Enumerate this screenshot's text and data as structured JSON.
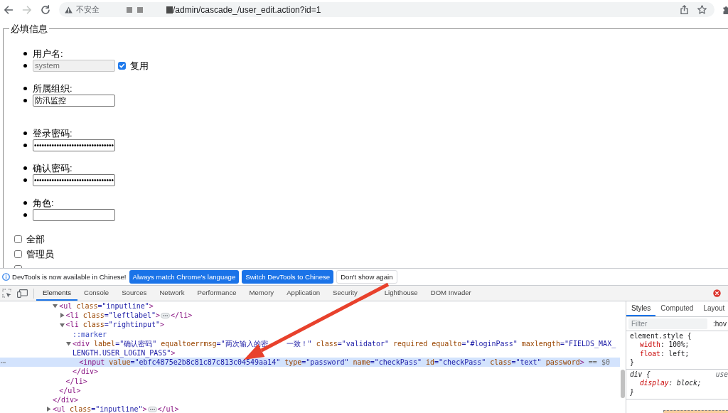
{
  "browser": {
    "nav_buttons": [
      {
        "disabled": false
      },
      {
        "disabled": true
      },
      {
        "disabled": false
      }
    ],
    "address_bar": {
      "security_label": "不安全",
      "url": "/admin/cascade_/user_edit.action?id=1"
    }
  },
  "page": {
    "legend": "必填信息",
    "fields": [
      {
        "label": "用户名:",
        "kind": "text",
        "value": "system",
        "disabled": true,
        "reuse": {
          "label": "复用",
          "checked": true
        }
      },
      {
        "label": "所属组织:",
        "kind": "text",
        "value": "防汛监控",
        "disabled": false
      },
      {
        "label": "登录密码:",
        "kind": "password",
        "value": "••••••••••••••••••••••••••••••••",
        "disabled": false
      },
      {
        "label": "确认密码:",
        "kind": "password",
        "value": "••••••••••••••••••••••••••••••••",
        "disabled": false
      },
      {
        "label": "角色:",
        "kind": "text",
        "disabled": false
      }
    ],
    "roles": [
      {
        "label": "全部",
        "checked": false
      },
      {
        "label": "管理员",
        "checked": false
      },
      {
        "checked": false
      }
    ]
  },
  "devtools": {
    "banner": {
      "message": "DevTools is now available in Chinese!",
      "buttons": [
        {
          "label": "Always match Chrome's language",
          "kind": "primary"
        },
        {
          "label": "Switch DevTools to Chinese",
          "kind": "primary"
        },
        {
          "label": "Don't show again",
          "kind": "secondary"
        }
      ]
    },
    "tabs": [
      {
        "label": "Elements",
        "selected": true
      },
      {
        "label": "Console",
        "selected": false
      },
      {
        "label": "Sources",
        "selected": false
      },
      {
        "label": "Network",
        "selected": false
      },
      {
        "label": "Performance",
        "selected": false
      },
      {
        "label": "Memory",
        "selected": false
      },
      {
        "label": "Application",
        "selected": false
      },
      {
        "label": "Security",
        "selected": false
      },
      {
        "label": "Lighthouse",
        "selected": false
      },
      {
        "label": "DOM Invader",
        "selected": false
      }
    ],
    "dom_tree": [
      {
        "kind": "element",
        "selected": false,
        "close_tag": "</div>",
        "children": [
          {
            "kind": "element",
            "open_tag": "<ul class=\"inputline\">",
            "expanded": true,
            "selected": false,
            "close_tag": "</ul>",
            "children": [
              {
                "kind": "element",
                "open_tag": "<li class=\"leftlabel\">",
                "expanded": false,
                "selected": false,
                "close_tag": "</li>"
              },
              {
                "kind": "element",
                "open_tag": "<li class=\"rightinput\">",
                "expanded": true,
                "selected": false,
                "close_tag": "</li>",
                "children": [
                  {
                    "kind": "pseudo",
                    "text": "::marker"
                  },
                  {
                    "kind": "element",
                    "open_tag": [
                      "<div label=\"确认密码\" equaltoerrmsg=\"两次输入的密",
                      "一致！\" class=\"validator\" required equalto=\"#loginPass\" maxlength=\"FIELDS_MAX_LENGTH.USER_LOGIN_PASS\">"
                    ],
                    "expanded": true,
                    "selected": false,
                    "close_tag": "</div>",
                    "children": [
                      {
                        "kind": "element",
                        "open_tag": "<input value=\"ebfc4875e2b8c81c87c813c04549aa14\" type=\"password\" name=\"checkPass\" id=\"checkPass\" class=\"text\" password>",
                        "selected": true,
                        "note": "== $0"
                      }
                    ]
                  }
                ]
              }
            ]
          }
        ]
      },
      {
        "kind": "element",
        "open_tag": "<ul class=\"inputline\">",
        "expanded": false,
        "selected": false,
        "close_tag": "</ul>"
      }
    ],
    "styles_pane": {
      "tabs": [
        {
          "label": "Styles",
          "selected": true
        },
        {
          "label": "Computed",
          "selected": false
        },
        {
          "label": "Layout",
          "selected": false
        }
      ],
      "filter": {
        "placeholder": "Filter"
      },
      "hov_button": ":hov",
      "rules": [
        {
          "kind": "inline",
          "selector": "element.style {",
          "properties": [
            "width: 100%;",
            "float: left;"
          ],
          "closing": "}"
        },
        {
          "kind": "user_agent",
          "selector": "div {",
          "source": "use",
          "properties": [
            "display: block;"
          ],
          "closing": "}"
        }
      ]
    }
  }
}
